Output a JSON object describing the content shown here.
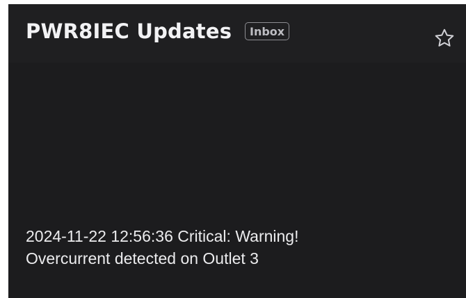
{
  "header": {
    "title": "PWR8IEC Updates",
    "label_badge": "Inbox",
    "star_icon": "star-outline-icon"
  },
  "message": {
    "line1": "2024-11-22 12:56:36 Critical: Warning!",
    "line2": "Overcurrent detected on Outlet 3"
  },
  "colors": {
    "background": "#1c1c1e",
    "text": "#ececee",
    "badge_border": "#8e8e93"
  }
}
